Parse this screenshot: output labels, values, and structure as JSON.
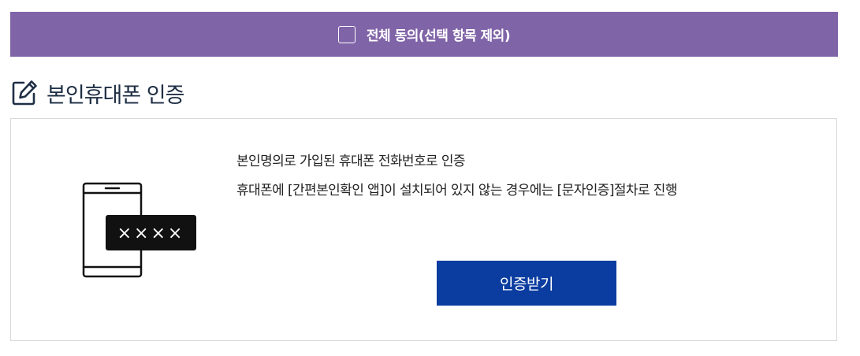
{
  "agree_all": {
    "label": "전체 동의(선택 항목 제외)",
    "checked": false,
    "bg_color": "#8064a8"
  },
  "section": {
    "icon": "edit-icon",
    "title": "본인휴대폰 인증"
  },
  "card": {
    "illustration_icon": "phone-with-code-icon",
    "code_mask": "××××",
    "lines": [
      "본인명의로 가입된 휴대폰 전화번호로 인증",
      "휴대폰에 [간편본인확인 앱]이 설치되어 있지 않는 경우에는 [문자인증]절차로 진행"
    ],
    "button_label": "인증받기",
    "button_color": "#0b3da0"
  }
}
